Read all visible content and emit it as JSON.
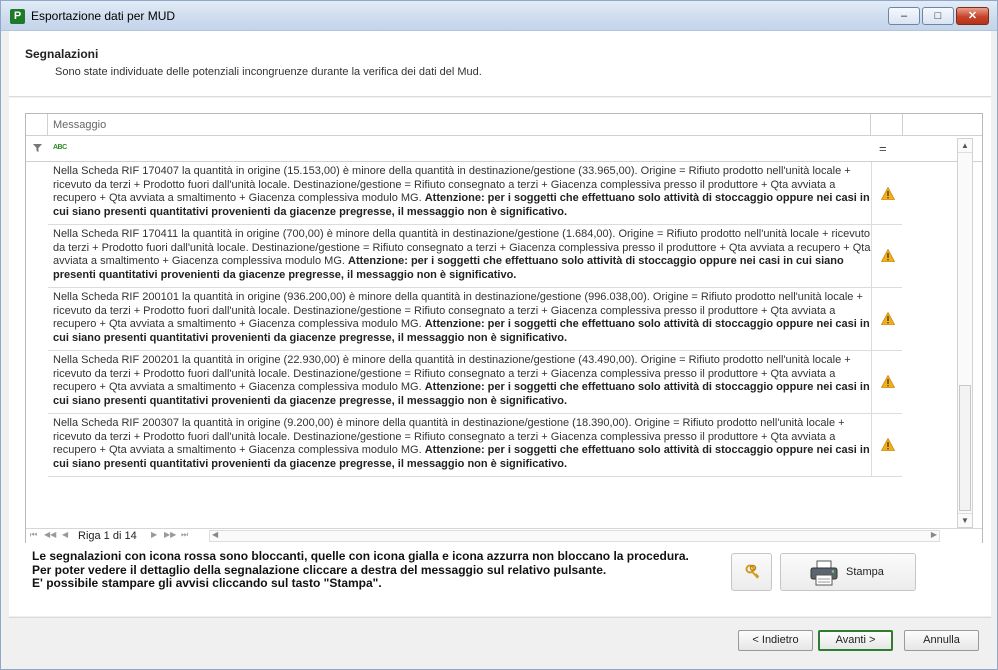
{
  "window": {
    "title": "Esportazione dati per MUD",
    "app_icon_letter": "P",
    "minimize_glyph": "–",
    "maximize_glyph": "□",
    "close_glyph": "✕"
  },
  "header": {
    "title": "Segnalazioni",
    "subtitle": "Sono state individuate delle potenziali incongruenze durante la verifica dei dati del Mud."
  },
  "grid": {
    "column_header": "Messaggio",
    "filter_text_icon": "ABC",
    "filter_eq_icon": "=",
    "rows": [
      {
        "text": "Nella Scheda RIF 170407 la quantità in origine (15.153,00) è minore della quantità in destinazione/gestione (33.965,00). Origine = Rifiuto prodotto nell'unità locale + ricevuto da terzi + Prodotto fuori dall'unità locale. Destinazione/gestione = Rifiuto consegnato a terzi + Giacenza complessiva presso il produttore + Qta avviata a recupero + Qta avviata a smaltimento + Giacenza complessiva modulo MG. ",
        "bold": "Attenzione: per i soggetti che effettuano solo attività di stoccaggio oppure nei casi in cui siano presenti quantitativi provenienti da giacenze pregresse, il messaggio non è significativo.",
        "icon": "warning-yellow-icon"
      },
      {
        "text": "Nella Scheda RIF 170411 la quantità in origine (700,00) è minore della quantità in destinazione/gestione (1.684,00). Origine = Rifiuto prodotto nell'unità locale + ricevuto da terzi + Prodotto fuori dall'unità locale. Destinazione/gestione = Rifiuto consegnato a terzi + Giacenza complessiva presso il produttore + Qta avviata a recupero + Qta avviata a smaltimento + Giacenza complessiva modulo MG. ",
        "bold": "Attenzione: per i soggetti che effettuano solo attività di stoccaggio oppure nei casi in cui siano presenti quantitativi provenienti da giacenze pregresse, il messaggio non è significativo.",
        "icon": "warning-yellow-icon"
      },
      {
        "text": "Nella Scheda RIF 200101 la quantità in origine (936.200,00) è minore della quantità in destinazione/gestione (996.038,00). Origine = Rifiuto prodotto nell'unità locale + ricevuto da terzi + Prodotto fuori dall'unità locale. Destinazione/gestione = Rifiuto consegnato a terzi + Giacenza complessiva presso il produttore + Qta avviata a recupero + Qta avviata a smaltimento + Giacenza complessiva modulo MG. ",
        "bold": "Attenzione: per i soggetti che effettuano solo attività di stoccaggio oppure nei casi in cui siano presenti quantitativi provenienti da giacenze pregresse, il messaggio non è significativo.",
        "icon": "warning-yellow-icon"
      },
      {
        "text": "Nella Scheda RIF 200201 la quantità in origine (22.930,00) è minore della quantità in destinazione/gestione (43.490,00). Origine = Rifiuto prodotto nell'unità locale + ricevuto da terzi + Prodotto fuori dall'unità locale. Destinazione/gestione = Rifiuto consegnato a terzi + Giacenza complessiva presso il produttore + Qta avviata a recupero + Qta avviata a smaltimento + Giacenza complessiva modulo MG. ",
        "bold": "Attenzione: per i soggetti che effettuano solo attività di stoccaggio oppure nei casi in cui siano presenti quantitativi provenienti da giacenze pregresse, il messaggio non è significativo.",
        "icon": "warning-yellow-icon"
      },
      {
        "text": "Nella Scheda RIF 200307 la quantità in origine (9.200,00) è minore della quantità in destinazione/gestione (18.390,00). Origine = Rifiuto prodotto nell'unità locale + ricevuto da terzi + Prodotto fuori dall'unità locale. Destinazione/gestione = Rifiuto consegnato a terzi + Giacenza complessiva presso il produttore + Qta avviata a recupero + Qta avviata a smaltimento + Giacenza complessiva modulo MG. ",
        "bold": "Attenzione: per i soggetti che effettuano solo attività di stoccaggio oppure nei casi in cui siano presenti quantitativi provenienti da giacenze pregresse, il messaggio non è significativo.",
        "icon": "warning-yellow-icon"
      }
    ],
    "pager": {
      "first": "⏮",
      "prev_page": "◀◀",
      "prev": "◀",
      "label": "Riga 1 di 14",
      "next": "▶",
      "next_page": "▶▶",
      "last": "⏭"
    }
  },
  "info_text": [
    "Le segnalazioni con icona rossa sono bloccanti, quelle con icona gialla e icona azzurra non bloccano la procedura.",
    "Per poter vedere il dettaglio della segnalazione cliccare a destra del messaggio sul relativo pulsante.",
    "E' possibile stampare gli avvisi cliccando sul tasto \"Stampa\"."
  ],
  "buttons": {
    "print": "Stampa",
    "back": "< Indietro",
    "next": "Avanti >",
    "cancel": "Annulla"
  },
  "colors": {
    "warning": "#f2b01e",
    "accent_green": "#2f7d2f"
  }
}
